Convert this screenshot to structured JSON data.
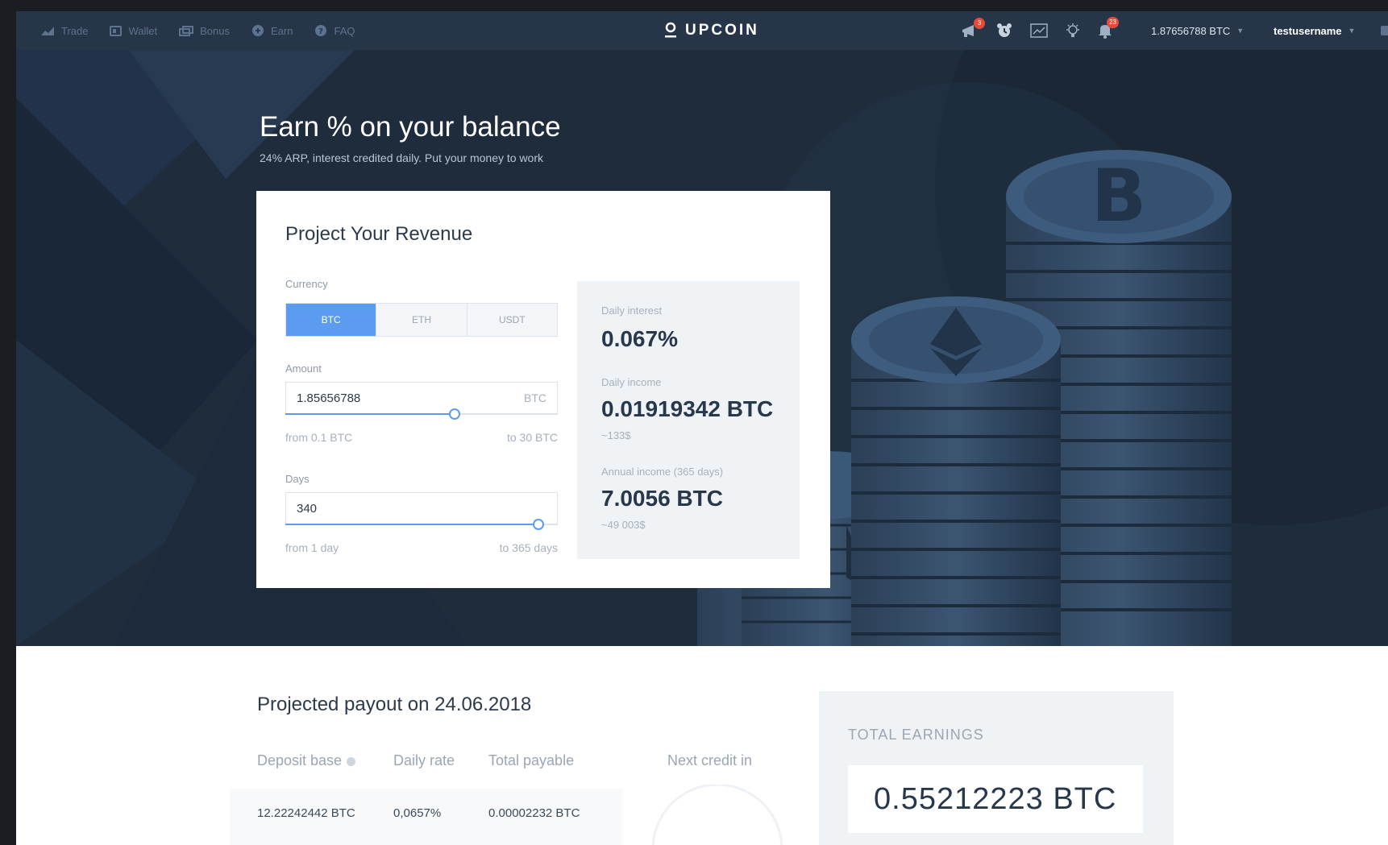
{
  "nav": {
    "items": [
      {
        "label": "Trade",
        "icon": "trade-chart-icon"
      },
      {
        "label": "Wallet",
        "icon": "wallet-icon"
      },
      {
        "label": "Bonus",
        "icon": "bonus-icon"
      },
      {
        "label": "Earn",
        "icon": "earn-coin-icon"
      },
      {
        "label": "FAQ",
        "icon": "help-icon"
      }
    ]
  },
  "brand": {
    "name": "UPCOIN"
  },
  "header_icons": {
    "megaphone_badge": "3",
    "bell_badge": "23"
  },
  "balance": {
    "label": "1.87656788 BTC"
  },
  "user": {
    "name": "testusername"
  },
  "hero": {
    "title": "Earn % on your balance",
    "subtitle": "24% ARP, interest credited daily. Put your money to work"
  },
  "calculator": {
    "title": "Project Your Revenue",
    "currency_label": "Currency",
    "currencies": [
      "BTC",
      "ETH",
      "USDT"
    ],
    "selected_currency": "BTC",
    "amount_label": "Amount",
    "amount_value": "1.85656788",
    "amount_unit": "BTC",
    "amount_min": "from 0.1 BTC",
    "amount_max": "to 30 BTC",
    "amount_slider_fraction": 0.62,
    "days_label": "Days",
    "days_value": "340",
    "days_min": "from 1 day",
    "days_max": "to 365 days",
    "days_slider_fraction": 0.93
  },
  "results": {
    "daily_interest_label": "Daily interest",
    "daily_interest_value": "0.067%",
    "daily_income_label": "Daily income",
    "daily_income_value": "0.01919342 BTC",
    "daily_income_sub": "~133$",
    "annual_income_label": "Annual income (365 days)",
    "annual_income_value": "7.0056 BTC",
    "annual_income_sub": "~49 003$"
  },
  "payout": {
    "title": "Projected payout on 24.06.2018",
    "headers": [
      "Deposit base",
      "Daily rate",
      "Total payable",
      "Next credit in"
    ],
    "row": [
      "12.22242442 BTC",
      "0,0657%",
      "0.00002232 BTC"
    ]
  },
  "earnings": {
    "label": "TOTAL EARNINGS",
    "value": "0.55212223 BTC"
  },
  "colors": {
    "accent": "#5b9cf0",
    "topbar": "#263547",
    "hero_bg": "#1e2c3c",
    "badge": "#e84a3a"
  }
}
